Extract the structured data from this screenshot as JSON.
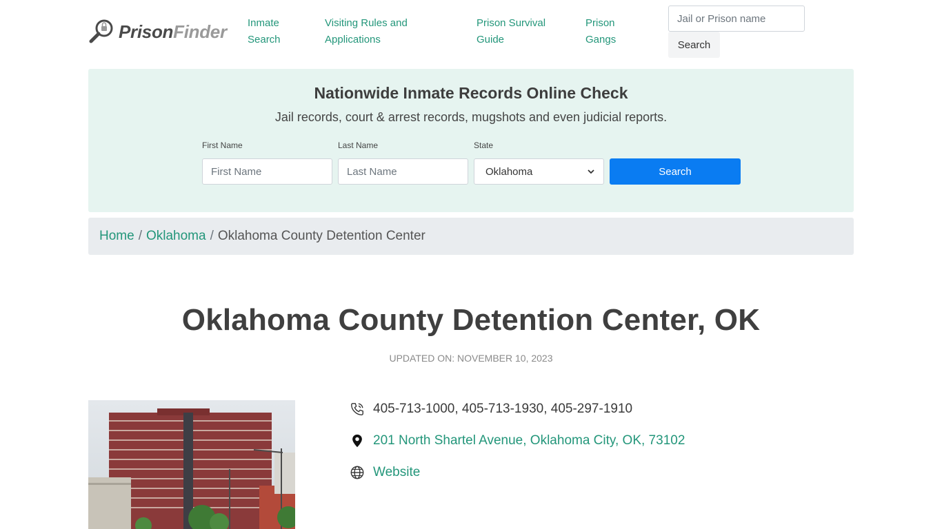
{
  "brand": {
    "name_part1": "Prison",
    "name_part2": "Finder"
  },
  "nav": [
    {
      "label": "Inmate Search"
    },
    {
      "label": "Visiting Rules and Applications"
    },
    {
      "label": "Prison Survival Guide"
    },
    {
      "label": "Prison Gangs"
    }
  ],
  "header_search": {
    "placeholder": "Jail or Prison name",
    "button_label": "Search"
  },
  "hero": {
    "title": "Nationwide Inmate Records Online Check",
    "subtitle": "Jail records, court & arrest records, mugshots and even judicial reports.",
    "first_name_label": "First Name",
    "first_name_placeholder": "First Name",
    "last_name_label": "Last Name",
    "last_name_placeholder": "Last Name",
    "state_label": "State",
    "state_value": "Oklahoma",
    "search_label": "Search"
  },
  "breadcrumb": {
    "home": "Home",
    "state": "Oklahoma",
    "current": "Oklahoma County Detention Center",
    "separator": "/"
  },
  "page": {
    "title": "Oklahoma County Detention Center, OK",
    "updated": "UPDATED ON: NOVEMBER 10, 2023"
  },
  "details": {
    "phones": "405-713-1000, 405-713-1930, 405-297-1910",
    "address": "201 North Shartel Avenue, Oklahoma City, OK, 73102",
    "website_label": "Website"
  },
  "colors": {
    "accent": "#23967a",
    "primary_button": "#0a7cf2",
    "hero_bg": "#e6f4f0",
    "breadcrumb_bg": "#e9ecef"
  },
  "icons": [
    "magnifier-logo-icon",
    "phone-icon",
    "map-pin-icon",
    "globe-icon",
    "chevron-down-icon"
  ]
}
